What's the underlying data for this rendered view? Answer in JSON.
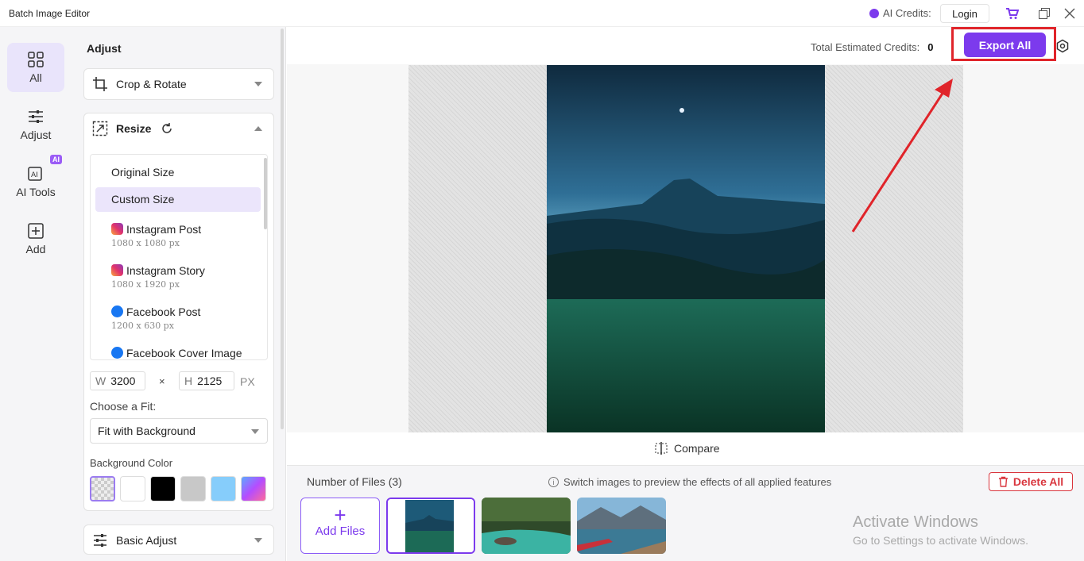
{
  "window": {
    "title": "Batch Image Editor",
    "ai_credits_label": "AI Credits:",
    "login_label": "Login"
  },
  "nav": [
    {
      "label": "All",
      "icon": "grid-icon"
    },
    {
      "label": "Adjust",
      "icon": "sliders-icon"
    },
    {
      "label": "AI Tools",
      "icon": "ai-tools-icon",
      "badge": "AI"
    },
    {
      "label": "Add",
      "icon": "add-square-icon"
    }
  ],
  "panel": {
    "title": "Adjust",
    "crop_label": "Crop & Rotate",
    "resize_label": "Resize",
    "sizes": [
      {
        "name": "Original Size",
        "dims": ""
      },
      {
        "name": "Custom Size",
        "dims": "",
        "selected": true
      },
      {
        "name": "Instagram Post",
        "dims": "1080 x 1080 px",
        "icon": "instagram-icon"
      },
      {
        "name": "Instagram Story",
        "dims": "1080 x 1920 px",
        "icon": "instagram-icon"
      },
      {
        "name": "Facebook Post",
        "dims": "1200 x 630 px",
        "icon": "facebook-icon"
      },
      {
        "name": "Facebook Cover Image",
        "dims": "",
        "icon": "facebook-icon"
      }
    ],
    "width_key": "W",
    "width_value": "3200",
    "times": "×",
    "height_key": "H",
    "height_value": "2125",
    "unit": "PX",
    "fit_label": "Choose a Fit:",
    "fit_value": "Fit with Background",
    "bg_color_label": "Background Color",
    "bg_colors": [
      "transparent",
      "#ffffff",
      "#000000",
      "#c8c8c8",
      "#86cdfb",
      "gradient"
    ],
    "basic_adjust_label": "Basic Adjust"
  },
  "header": {
    "credits_label": "Total Estimated Credits:",
    "credits_value": "0",
    "export_label": "Export All"
  },
  "compare_label": "Compare",
  "files": {
    "count_label": "Number of Files (3)",
    "hint": "Switch images to preview the effects of all applied features",
    "delete_label": "Delete All",
    "add_label": "Add Files"
  },
  "watermark": {
    "line1": "Activate Windows",
    "line2": "Go to Settings to activate Windows."
  },
  "colors": {
    "accent": "#7c3aed",
    "highlight": "#e0242a",
    "danger": "#d9363e"
  }
}
